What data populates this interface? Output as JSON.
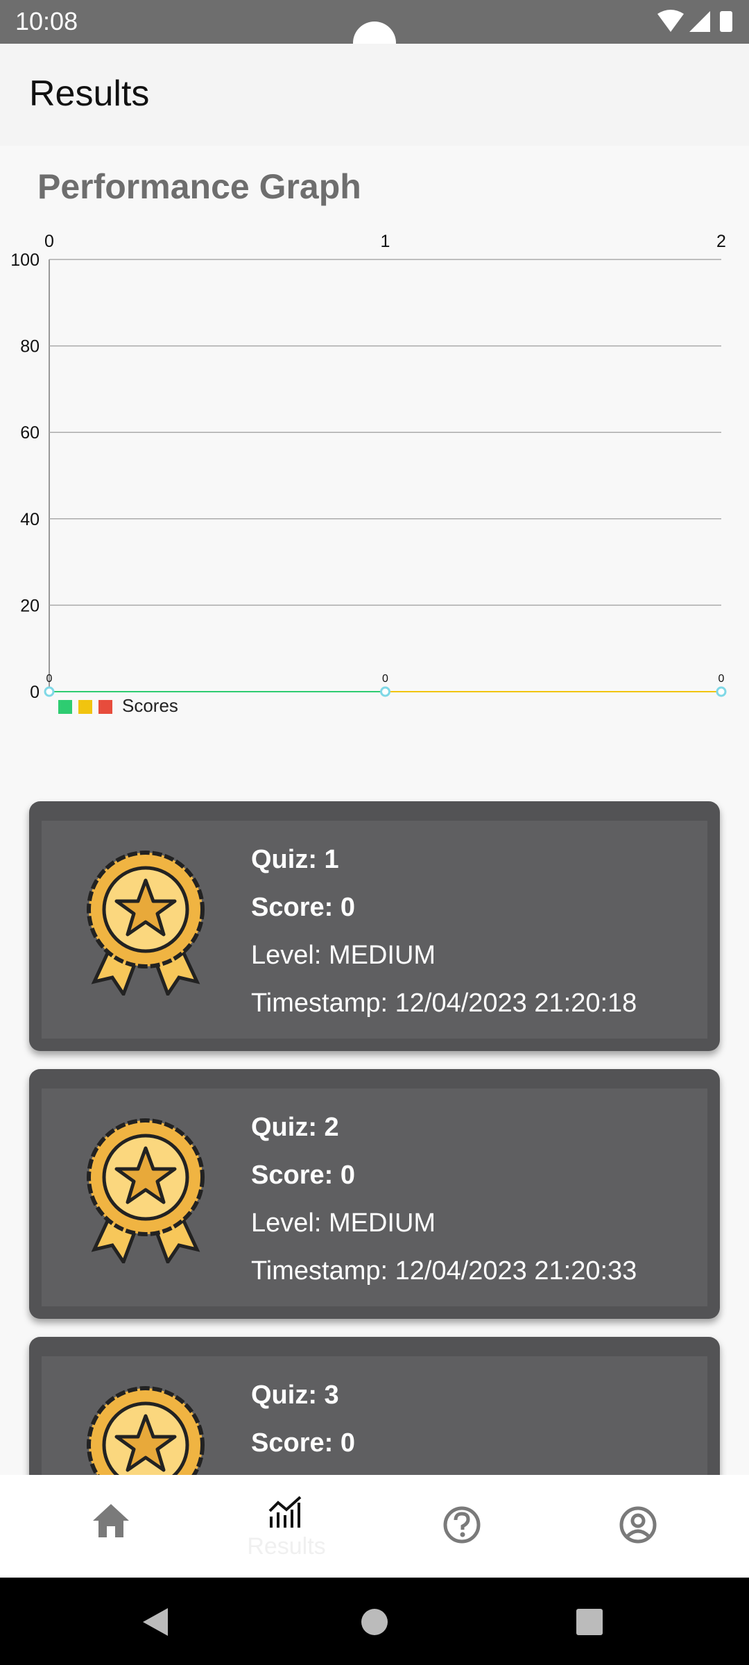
{
  "status_bar": {
    "time": "10:08"
  },
  "app_bar": {
    "title": "Results"
  },
  "graph": {
    "heading": "Performance Graph",
    "legend_label": "Scores",
    "legend_colors": [
      "#2ecc71",
      "#f1c40f",
      "#e74c3c"
    ]
  },
  "chart_data": {
    "type": "line",
    "x": [
      0,
      1,
      2
    ],
    "x_tick_labels": [
      "0",
      "1",
      "2"
    ],
    "y_ticks": [
      "0",
      "20",
      "40",
      "60",
      "80",
      "100"
    ],
    "ylim": [
      0,
      100
    ],
    "xlim": [
      0,
      2
    ],
    "grid": true,
    "legend_position": "bottom-left",
    "series": [
      {
        "name": "Scores",
        "values": [
          0,
          0,
          0
        ],
        "point_labels": [
          "0",
          "0",
          "0"
        ]
      }
    ]
  },
  "results": [
    {
      "quiz": "Quiz: 1",
      "score": "Score: 0",
      "level": "Level: MEDIUM",
      "timestamp": "Timestamp: 12/04/2023 21:20:18"
    },
    {
      "quiz": "Quiz: 2",
      "score": "Score: 0",
      "level": "Level: MEDIUM",
      "timestamp": "Timestamp: 12/04/2023 21:20:33"
    },
    {
      "quiz": "Quiz: 3",
      "score": "Score: 0",
      "level": "",
      "timestamp": ""
    }
  ],
  "bottom_nav": {
    "items": [
      {
        "icon": "home-icon",
        "label": ""
      },
      {
        "icon": "chart-icon",
        "label": "Results"
      },
      {
        "icon": "help-icon",
        "label": ""
      },
      {
        "icon": "profile-icon",
        "label": ""
      }
    ]
  },
  "colors": {
    "card": "#535355",
    "card_inner": "#5f5f61",
    "status_bar": "#6e6e6e"
  }
}
